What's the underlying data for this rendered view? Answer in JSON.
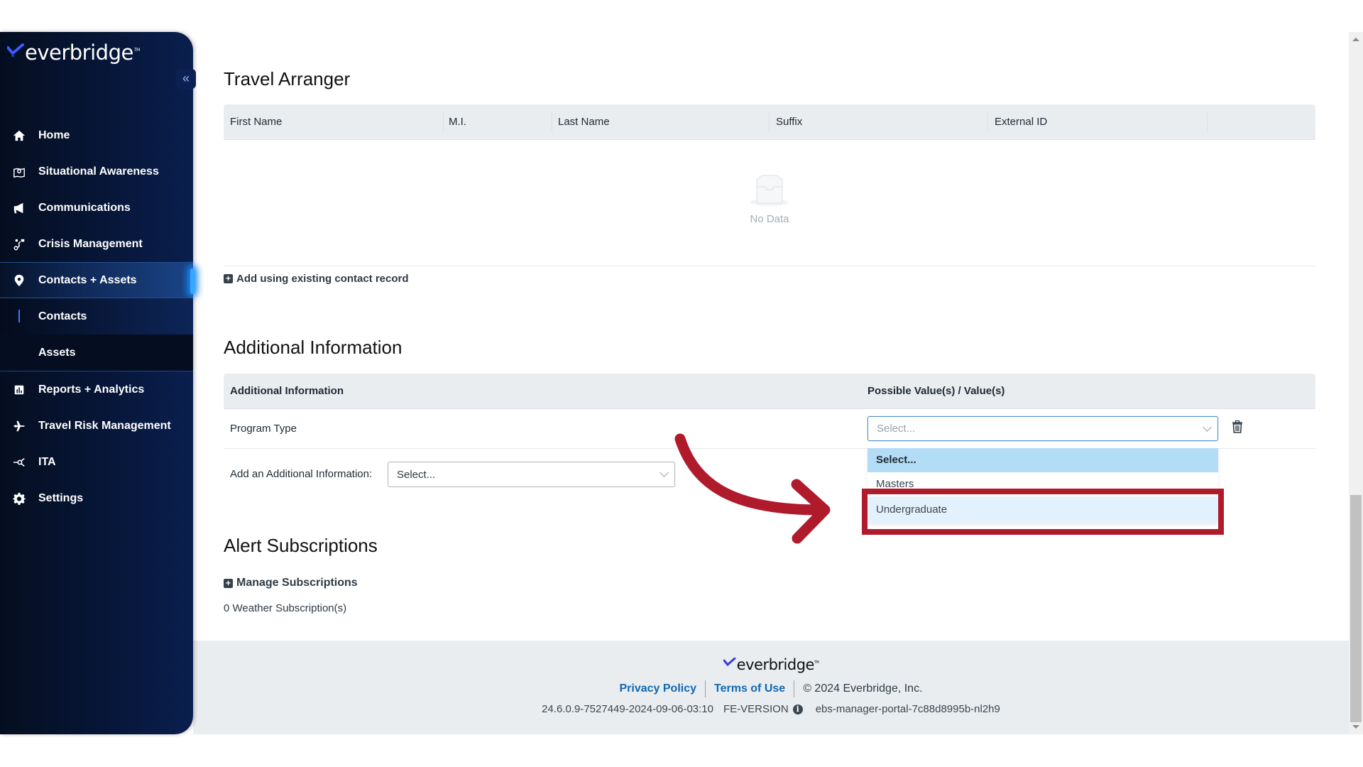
{
  "sidebar": {
    "brand": "everbridge",
    "collapse_label": "«",
    "items": [
      {
        "label": "Home",
        "icon": "home-icon"
      },
      {
        "label": "Situational Awareness",
        "icon": "map-pin-icon"
      },
      {
        "label": "Communications",
        "icon": "megaphone-icon"
      },
      {
        "label": "Crisis Management",
        "icon": "route-icon"
      },
      {
        "label": "Contacts + Assets",
        "icon": "location-icon",
        "active": true
      },
      {
        "label": "Contacts",
        "sub": true,
        "current": true
      },
      {
        "label": "Assets",
        "sub": true
      },
      {
        "label": "Reports + Analytics",
        "icon": "bar-chart-icon"
      },
      {
        "label": "Travel Risk Management",
        "icon": "airplane-icon"
      },
      {
        "label": "ITA",
        "icon": "network-icon"
      },
      {
        "label": "Settings",
        "icon": "gear-icon"
      }
    ]
  },
  "travel_arranger": {
    "title": "Travel Arranger",
    "columns": [
      "First Name",
      "M.I.",
      "Last Name",
      "Suffix",
      "External ID",
      ""
    ],
    "rows": [],
    "empty_text": "No Data",
    "add_link": "Add using existing contact record"
  },
  "additional_info": {
    "title": "Additional Information",
    "columns": [
      "Additional Information",
      "Possible Value(s) / Value(s)"
    ],
    "rows": [
      {
        "label": "Program Type",
        "value_placeholder": "Select..."
      }
    ],
    "add_label": "Add an Additional Information:",
    "add_select_value": "Select...",
    "dropdown_options": [
      {
        "label": "Select...",
        "state": "selected"
      },
      {
        "label": "Masters",
        "state": "normal"
      },
      {
        "label": "Undergraduate",
        "state": "hover"
      }
    ]
  },
  "alert_subscriptions": {
    "title": "Alert Subscriptions",
    "manage_link": "Manage Subscriptions",
    "weather_count": "0 Weather Subscription(s)"
  },
  "annotation": {
    "highlight_color": "#b01b2c",
    "target_option": "Undergraduate"
  },
  "footer": {
    "brand": "everbridge",
    "privacy": "Privacy Policy",
    "terms": "Terms of Use",
    "copyright": "© 2024 Everbridge, Inc.",
    "build": "24.6.0.9-7527449-2024-09-06-03:10",
    "fe_version_label": "FE-VERSION",
    "instance": "ebs-manager-portal-7c88d8995b-nl2h9"
  }
}
